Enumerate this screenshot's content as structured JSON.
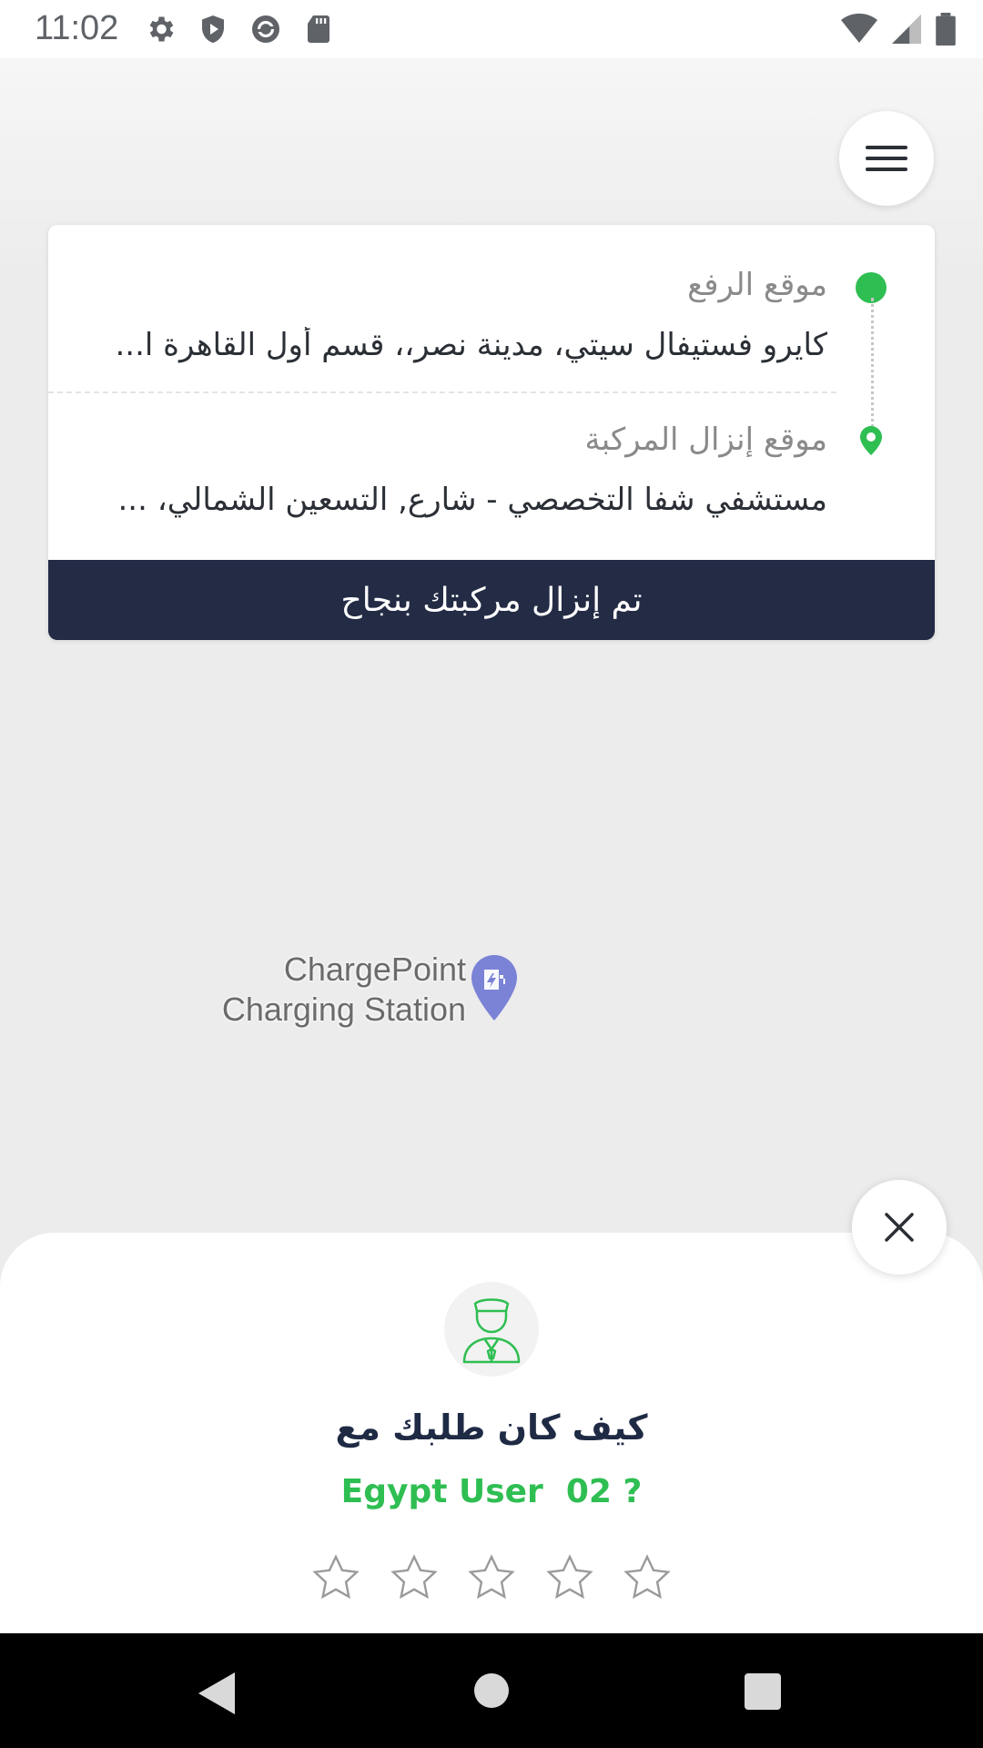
{
  "status_bar": {
    "time": "11:02",
    "left_icons": [
      "settings-icon",
      "shield-icon",
      "sync-icon",
      "sd-card-icon"
    ],
    "right_icons": [
      "wifi-icon",
      "signal-icon",
      "battery-icon"
    ]
  },
  "map": {
    "poi_name_line1": "ChargePoint",
    "poi_name_line2": "Charging Station",
    "poi_icon": "ev-charging-pin-icon"
  },
  "trip_card": {
    "pickup_label": "موقع الرفع",
    "pickup_address": "كايرو فستيفال سيتي، مدينة نصر،، قسم أول القاهرة ا...",
    "dropoff_label": "موقع إنزال المركبة",
    "dropoff_address": "مستشفي شفا التخصصي - شارع, التسعين الشمالي، ...",
    "status_text": "تم إنزال مركبتك بنجاح"
  },
  "rating_sheet": {
    "question": "كيف كان طلبك مع",
    "driver_name": "Egypt User  02 ?",
    "star_count": 5,
    "selected_stars": 0
  },
  "colors": {
    "accent_green": "#2fbe52",
    "dark_navy": "#232b45",
    "poi_purple": "#7b83d6"
  }
}
